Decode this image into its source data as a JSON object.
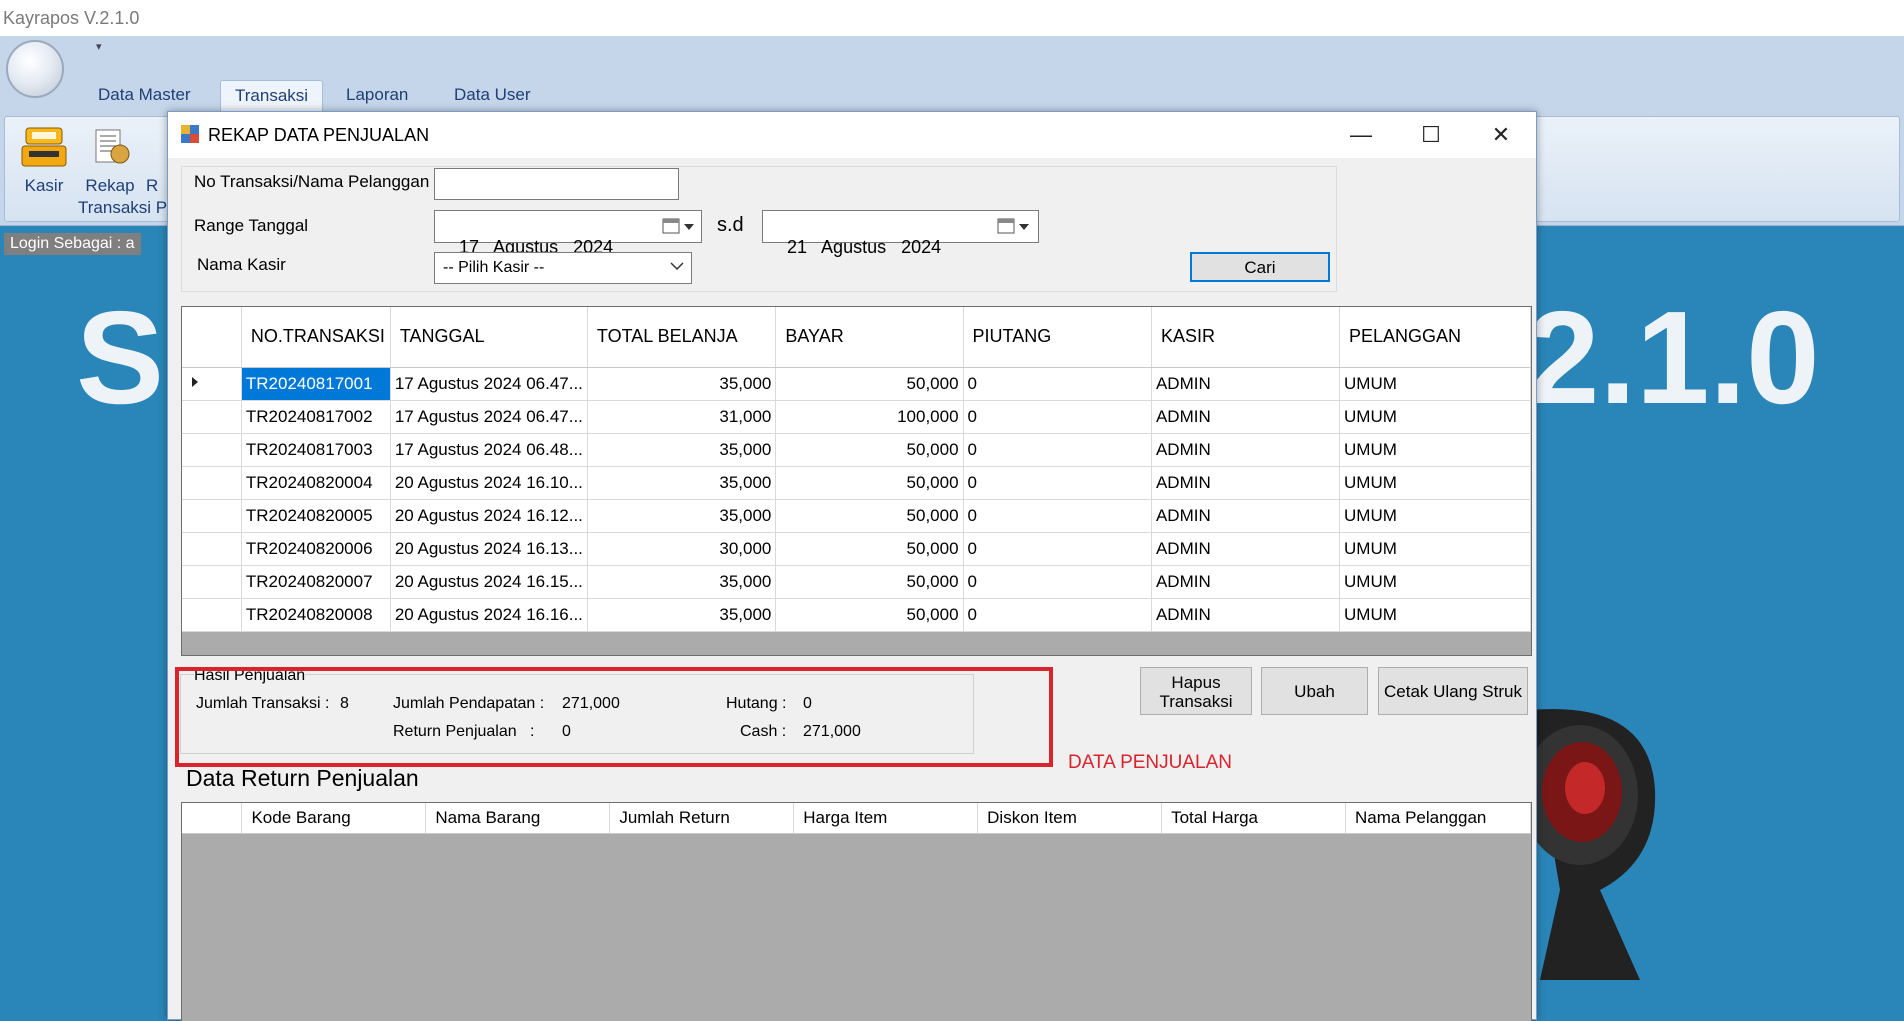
{
  "window": {
    "title": "Kayrapos V.2.1.0"
  },
  "ribbon": {
    "tabs": [
      "Data Master",
      "Transaksi",
      "Laporan",
      "Data User"
    ],
    "active_tab": "Transaksi",
    "buttons": [
      {
        "label": "Kasir",
        "icon": "cash-register-icon"
      },
      {
        "label": "Rekap",
        "icon": "report-icon"
      },
      {
        "label": "R",
        "icon": ""
      }
    ],
    "group_label": "Transaksi P"
  },
  "status": {
    "login_text": "Login Sebagai :  a"
  },
  "splash": {
    "left": "S",
    "right": "2.1.0"
  },
  "dialog": {
    "title": "REKAP DATA PENJUALAN",
    "filters": {
      "search_label": "No Transaksi/Nama Pelanggan",
      "search_value": "",
      "range_label": "Range Tanggal",
      "date_from": "17   Agustus   2024",
      "sd_label": "s.d",
      "date_to": "21   Agustus   2024",
      "cashier_label": "Nama Kasir",
      "cashier_value": "-- Pilih Kasir --",
      "search_button": "Cari"
    },
    "sales_grid": {
      "columns": [
        "NO.TRANSAKSI",
        "TANGGAL",
        "TOTAL BELANJA",
        "BAYAR",
        "PIUTANG",
        "KASIR",
        "PELANGGAN"
      ],
      "rows": [
        [
          "TR20240817001",
          "17 Agustus 2024 06.47...",
          "35,000",
          "50,000",
          "0",
          "ADMIN",
          "UMUM"
        ],
        [
          "TR20240817002",
          "17 Agustus 2024 06.47...",
          "31,000",
          "100,000",
          "0",
          "ADMIN",
          "UMUM"
        ],
        [
          "TR20240817003",
          "17 Agustus 2024 06.48...",
          "35,000",
          "50,000",
          "0",
          "ADMIN",
          "UMUM"
        ],
        [
          "TR20240820004",
          "20 Agustus 2024 16.10...",
          "35,000",
          "50,000",
          "0",
          "ADMIN",
          "UMUM"
        ],
        [
          "TR20240820005",
          "20 Agustus 2024 16.12...",
          "35,000",
          "50,000",
          "0",
          "ADMIN",
          "UMUM"
        ],
        [
          "TR20240820006",
          "20 Agustus 2024 16.13...",
          "30,000",
          "50,000",
          "0",
          "ADMIN",
          "UMUM"
        ],
        [
          "TR20240820007",
          "20 Agustus 2024 16.15...",
          "35,000",
          "50,000",
          "0",
          "ADMIN",
          "UMUM"
        ],
        [
          "TR20240820008",
          "20 Agustus 2024 16.16...",
          "35,000",
          "50,000",
          "0",
          "ADMIN",
          "UMUM"
        ]
      ]
    },
    "summary": {
      "group_title": "Hasil Penjualan",
      "jumlah_transaksi_label": "Jumlah Transaksi :",
      "jumlah_transaksi": "8",
      "pendapatan_label": "Jumlah Pendapatan :",
      "pendapatan": "271,000",
      "hutang_label": "Hutang :",
      "hutang": "0",
      "return_label": "Return Penjualan   :",
      "return_value": "0",
      "cash_label": "Cash :",
      "cash": "271,000"
    },
    "actions": {
      "hapus": "Hapus Transaksi",
      "ubah": "Ubah",
      "cetak": "Cetak Ulang Struk"
    },
    "annotation": "DATA PENJUALAN",
    "return_section": {
      "title": "Data Return Penjualan",
      "columns": [
        "Kode Barang",
        "Nama Barang",
        "Jumlah Return",
        "Harga Item",
        "Diskon Item",
        "Total Harga",
        "Nama Pelanggan"
      ]
    }
  },
  "colors": {
    "annotation_red": "#d9232d",
    "selection_blue": "#0078d7",
    "background_blue": "#2a86b8"
  }
}
